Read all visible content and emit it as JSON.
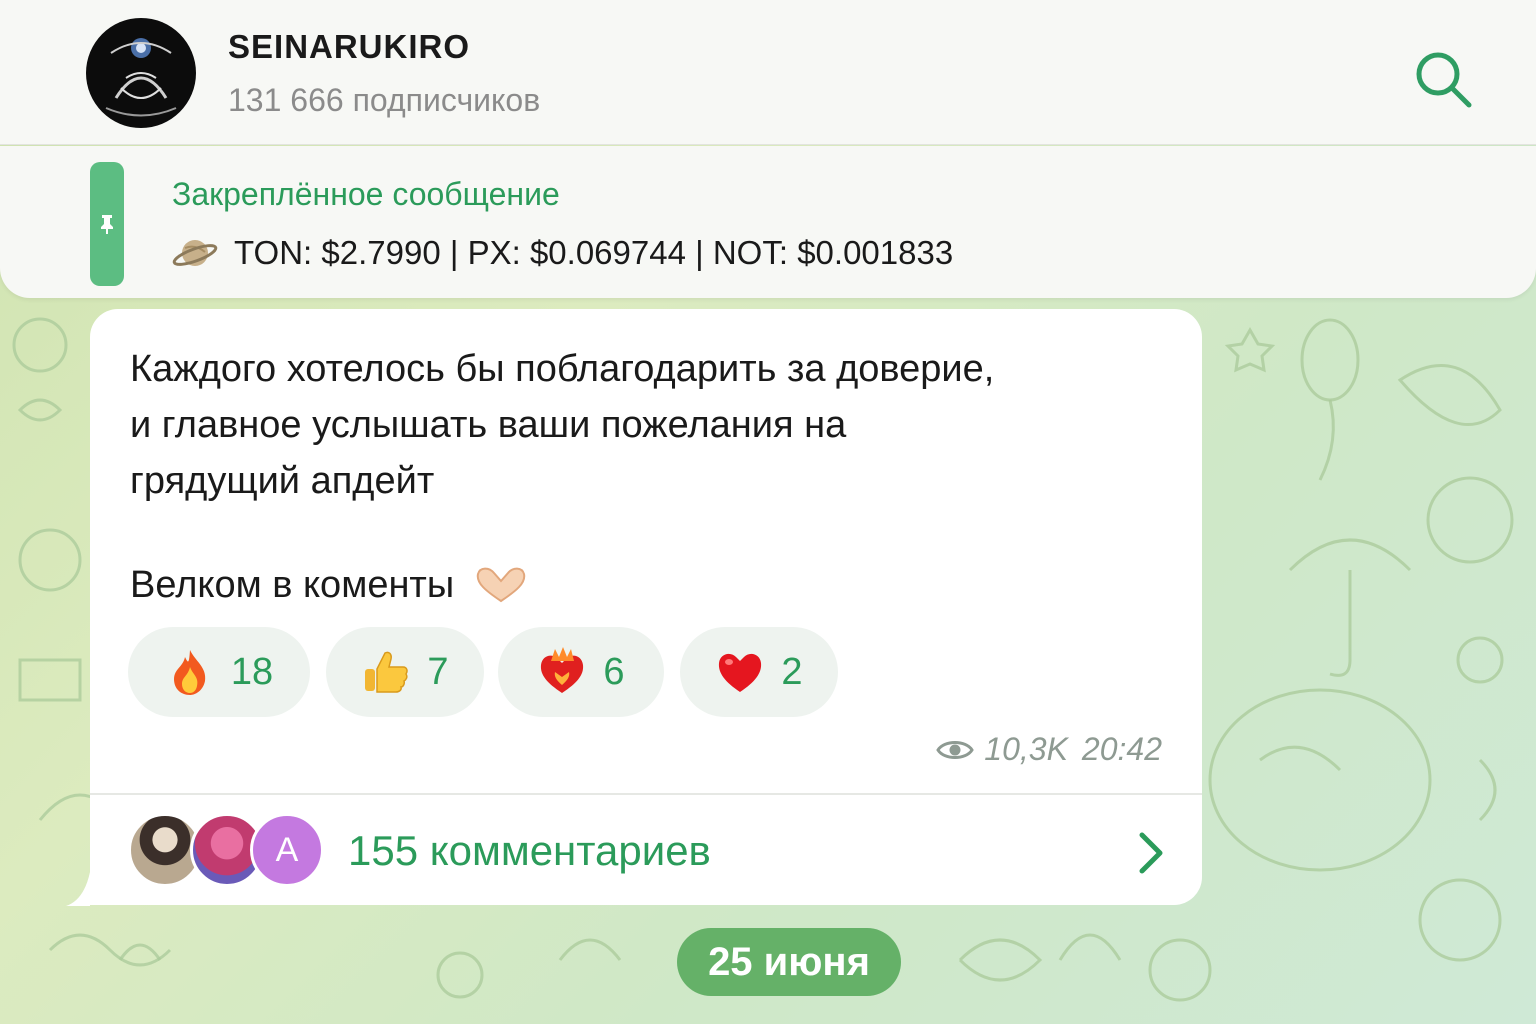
{
  "header": {
    "channel_name": "SEINARUKIRO",
    "subscribers": "131 666 подписчиков"
  },
  "pinned": {
    "title": "Закреплённое сообщение",
    "text": "TON: $2.7990 | PX: $0.069744 | NOT: $0.001833"
  },
  "message": {
    "text": "Каждого хотелось бы поблагодарить за доверие,\nи главное услышать ваши пожелания на\nгрядущий апдейт",
    "last_line": "Велком в коменты",
    "reactions": [
      {
        "icon": "fire-icon",
        "count": "18"
      },
      {
        "icon": "thumbs-up-icon",
        "count": "7"
      },
      {
        "icon": "heart-on-fire-icon",
        "count": "6"
      },
      {
        "icon": "red-heart-icon",
        "count": "2"
      }
    ],
    "views": "10,3K",
    "time": "20:42",
    "comments": {
      "avatar_letter": "A",
      "label": "155 комментариев"
    }
  },
  "date_separator": "25 июня",
  "colors": {
    "accent": "#2b9b5a",
    "pin_bar": "#5cbd82",
    "date_pill": "#65b168",
    "bubble": "#ffffff",
    "header": "#f7f8f5"
  }
}
